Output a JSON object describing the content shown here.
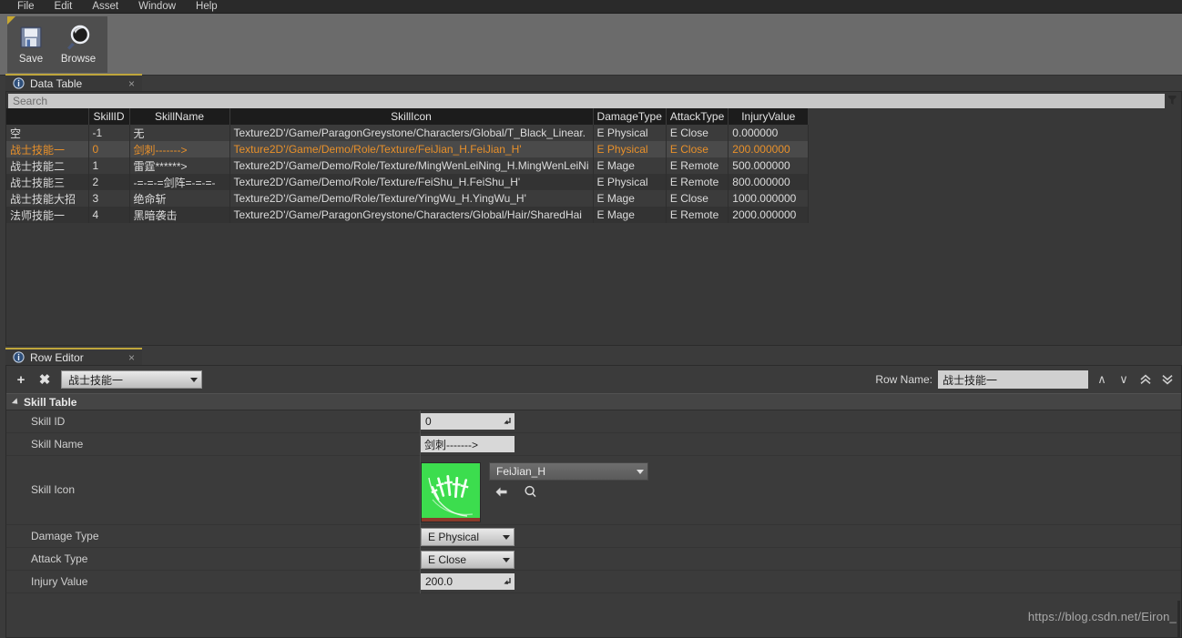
{
  "menubar": {
    "items": [
      {
        "label": "File"
      },
      {
        "label": "Edit"
      },
      {
        "label": "Asset"
      },
      {
        "label": "Window"
      },
      {
        "label": "Help"
      }
    ]
  },
  "toolbar": {
    "buttons": [
      {
        "label": "Save",
        "icon": "floppy-disk-icon"
      },
      {
        "label": "Browse",
        "icon": "magnifier-icon"
      }
    ]
  },
  "data_table_panel": {
    "tab_title": "Data Table",
    "tab_icon": "info-magnifier-icon",
    "close_label": "×",
    "search": {
      "placeholder": "Search",
      "value": ""
    },
    "columns": [
      {
        "key": "rowname",
        "label": ""
      },
      {
        "key": "skillid",
        "label": "SkillID"
      },
      {
        "key": "skillname",
        "label": "SkillName"
      },
      {
        "key": "skillicon",
        "label": "SkillIcon"
      },
      {
        "key": "damagetype",
        "label": "DamageType"
      },
      {
        "key": "attacktype",
        "label": "AttackType"
      },
      {
        "key": "injuryvalue",
        "label": "InjuryValue"
      }
    ],
    "rows": [
      {
        "rowname": "空",
        "skillid": "-1",
        "skillname": "无",
        "skillicon": "Texture2D'/Game/ParagonGreystone/Characters/Global/T_Black_Linear.",
        "damagetype": "E Physical",
        "attacktype": "E Close",
        "injuryvalue": "0.000000",
        "selected": false
      },
      {
        "rowname": "战士技能一",
        "skillid": "0",
        "skillname": "剑刺------->",
        "skillicon": "Texture2D'/Game/Demo/Role/Texture/FeiJian_H.FeiJian_H'",
        "damagetype": "E Physical",
        "attacktype": "E Close",
        "injuryvalue": "200.000000",
        "selected": true
      },
      {
        "rowname": "战士技能二",
        "skillid": "1",
        "skillname": "雷霆******>",
        "skillicon": "Texture2D'/Game/Demo/Role/Texture/MingWenLeiNing_H.MingWenLeiNi",
        "damagetype": "E Mage",
        "attacktype": "E Remote",
        "injuryvalue": "500.000000",
        "selected": false
      },
      {
        "rowname": "战士技能三",
        "skillid": "2",
        "skillname": "-=-=-=剑阵=-=-=-",
        "skillicon": "Texture2D'/Game/Demo/Role/Texture/FeiShu_H.FeiShu_H'",
        "damagetype": "E Physical",
        "attacktype": "E Remote",
        "injuryvalue": "800.000000",
        "selected": false
      },
      {
        "rowname": "战士技能大招",
        "skillid": "3",
        "skillname": "绝命斩",
        "skillicon": "Texture2D'/Game/Demo/Role/Texture/YingWu_H.YingWu_H'",
        "damagetype": "E Mage",
        "attacktype": "E Close",
        "injuryvalue": "1000.000000",
        "selected": false
      },
      {
        "rowname": "法师技能一",
        "skillid": "4",
        "skillname": "黑暗袭击",
        "skillicon": "Texture2D'/Game/ParagonGreystone/Characters/Global/Hair/SharedHai",
        "damagetype": "E Mage",
        "attacktype": "E Remote",
        "injuryvalue": "2000.000000",
        "selected": false
      }
    ]
  },
  "row_editor_panel": {
    "tab_title": "Row Editor",
    "tab_icon": "info-magnifier-icon",
    "close_label": "×",
    "add_row_label": "+",
    "remove_row_label": "✖",
    "row_selector_value": "战士技能一",
    "row_name_label": "Row Name:",
    "row_name_value": "战士技能一",
    "nav_buttons": [
      {
        "icon": "chevron-up-icon",
        "glyph": "∧"
      },
      {
        "icon": "chevron-down-icon",
        "glyph": "∨"
      },
      {
        "icon": "double-chevron-up-icon",
        "glyph": "«"
      },
      {
        "icon": "double-chevron-down-icon",
        "glyph": "»"
      }
    ],
    "section": {
      "title": "Skill Table",
      "expanded": true
    },
    "properties": {
      "skill_id": {
        "label": "Skill ID",
        "value": "0"
      },
      "skill_name": {
        "label": "Skill Name",
        "value": "剑刺------->"
      },
      "skill_icon": {
        "label": "Skill Icon",
        "asset_name": "FeiJian_H",
        "thumbnail_color": "#3cdd4e",
        "thumbnail_icon": "flying-swords-icon",
        "actions": [
          {
            "icon": "use-selected-asset-icon",
            "glyph": "⬅"
          },
          {
            "icon": "browse-to-asset-icon",
            "glyph": "⌕"
          }
        ]
      },
      "damage_type": {
        "label": "Damage Type",
        "value": "E Physical"
      },
      "attack_type": {
        "label": "Attack Type",
        "value": "E Close"
      },
      "injury_value": {
        "label": "Injury Value",
        "value": "200.0"
      }
    }
  },
  "watermark": {
    "text": "https://blog.csdn.net/Eiron_"
  },
  "colors": {
    "accent_orange": "#e8902a",
    "tab_accent": "#bfa63c",
    "panel_bg": "#3b3b3b",
    "header_bg": "#1c1c1c",
    "toolbar_bg": "#6b6b6b"
  }
}
